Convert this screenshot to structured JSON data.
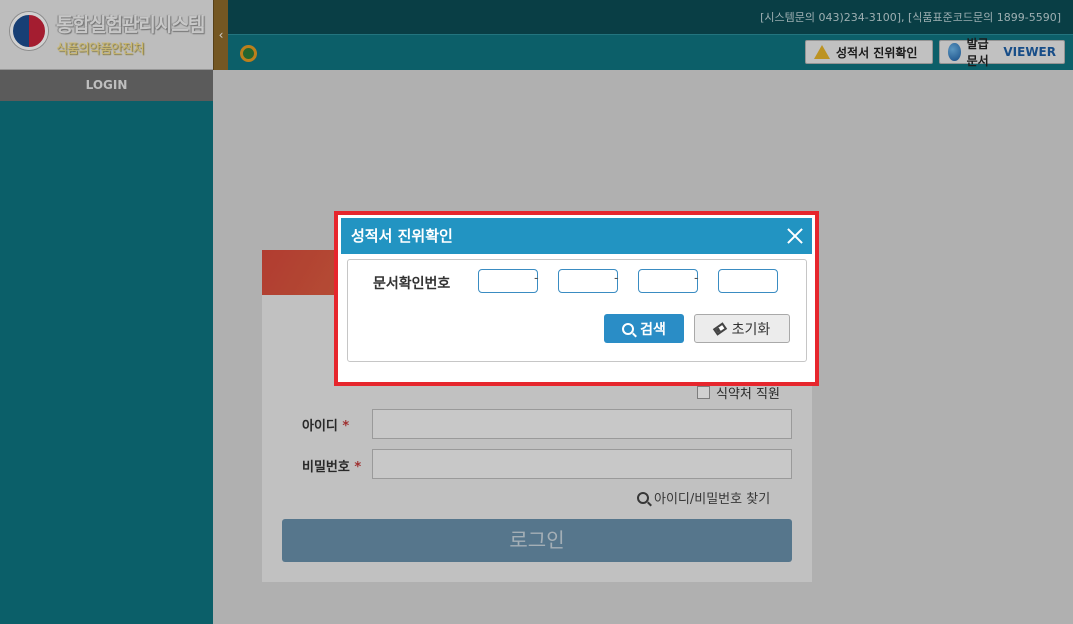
{
  "logo": {
    "title": "통합실험관리시스템",
    "subtitle": "식품의약품안전처"
  },
  "sidebar": {
    "login_tab": "LOGIN",
    "collapse_icon": "‹"
  },
  "header": {
    "contact": "[시스템문의 043)234-3100], [식품표준코드문의 1899-5590]",
    "verify_button": "성적서 진위확인",
    "viewer_button_prefix": "발급문서",
    "viewer_button_suffix": "VIEWER"
  },
  "login_form": {
    "staff_checkbox": "식약처 직원",
    "id_label": "아이디",
    "password_label": "비밀번호",
    "required_mark": "*",
    "find_link": "아이디/비밀번호 찾기",
    "login_button": "로그인"
  },
  "modal": {
    "title": "성적서 진위확인",
    "doc_label": "문서확인번호",
    "separator": "-",
    "search_button": "검색",
    "reset_button": "초기화"
  },
  "colors": {
    "modal_header": "#2294c2",
    "highlight_border": "#e6262d",
    "sidebar": "#0e7480"
  }
}
